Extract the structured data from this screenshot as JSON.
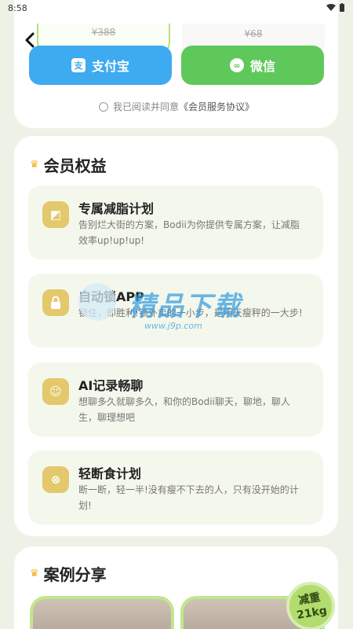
{
  "status_bar": {
    "time": "8:58"
  },
  "plans": {
    "left_original_price": "¥388",
    "right_original_price": "¥68"
  },
  "payment": {
    "alipay_label": "支付宝",
    "alipay_icon_glyph": "支",
    "wechat_label": "微信",
    "wechat_icon_glyph": "∞"
  },
  "agreement": {
    "prefix": "我已阅读并同意",
    "link": "《会员服务协议》"
  },
  "benefits": {
    "title": "会员权益",
    "items": [
      {
        "title": "专属减脂计划",
        "desc": "告别烂大街的方案，Bodii为你提供专属方案，让减脂效率up!up!up!",
        "icon": "plan-icon",
        "icon_glyph": "◩"
      },
      {
        "title": "自动锁APP",
        "desc": "锁住，即胜利!锁外卖的一小步，是明天瘦秤的一大步!",
        "icon": "lock-icon",
        "icon_glyph": "🔒"
      },
      {
        "title": "AI记录畅聊",
        "desc": "想聊多久就聊多久，和你的Bodii聊天，聊地，聊人生，聊理想吧",
        "icon": "chat-icon",
        "icon_glyph": "☺"
      },
      {
        "title": "轻断食计划",
        "desc": "断一断，轻一半!没有瘦不下去的人，只有没开始的计划!",
        "icon": "fasting-icon",
        "icon_glyph": "⊗"
      }
    ]
  },
  "cases": {
    "title": "案例分享",
    "badge_line1": "减重",
    "badge_line2": "21kg"
  },
  "watermark": {
    "text": "精品下载",
    "url": "www.j9p.com"
  },
  "colors": {
    "alipay": "#3eaaf0",
    "wechat": "#5ec85a",
    "accent_green": "#b2dc6e",
    "icon_gold": "#e3c86c"
  }
}
